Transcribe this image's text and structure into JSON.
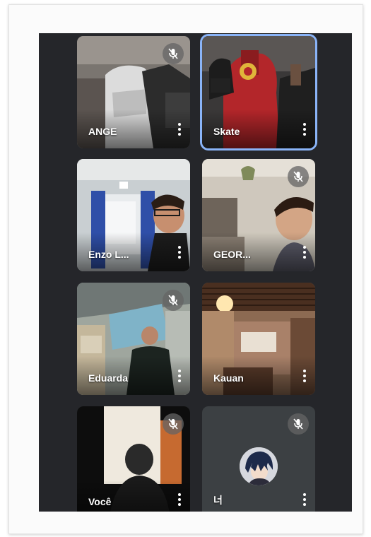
{
  "participants": [
    {
      "name": "ANGE",
      "muted": true,
      "active": false
    },
    {
      "name": "Skate",
      "muted": false,
      "active": true
    },
    {
      "name": "Enzo L...",
      "muted": false,
      "active": false
    },
    {
      "name": "GEOR...",
      "muted": true,
      "active": false
    },
    {
      "name": "Eduarda",
      "muted": true,
      "active": false
    },
    {
      "name": "Kauan",
      "muted": false,
      "active": false
    },
    {
      "name": "Você",
      "muted": true,
      "active": false
    },
    {
      "name": "너",
      "muted": true,
      "active": false
    }
  ],
  "colors": {
    "background": "#25262a",
    "active_border": "#8ab4f8",
    "avatar_tile": "#3c4043"
  },
  "icons": {
    "mute": "mic-off-icon",
    "more": "more-vert-icon"
  }
}
